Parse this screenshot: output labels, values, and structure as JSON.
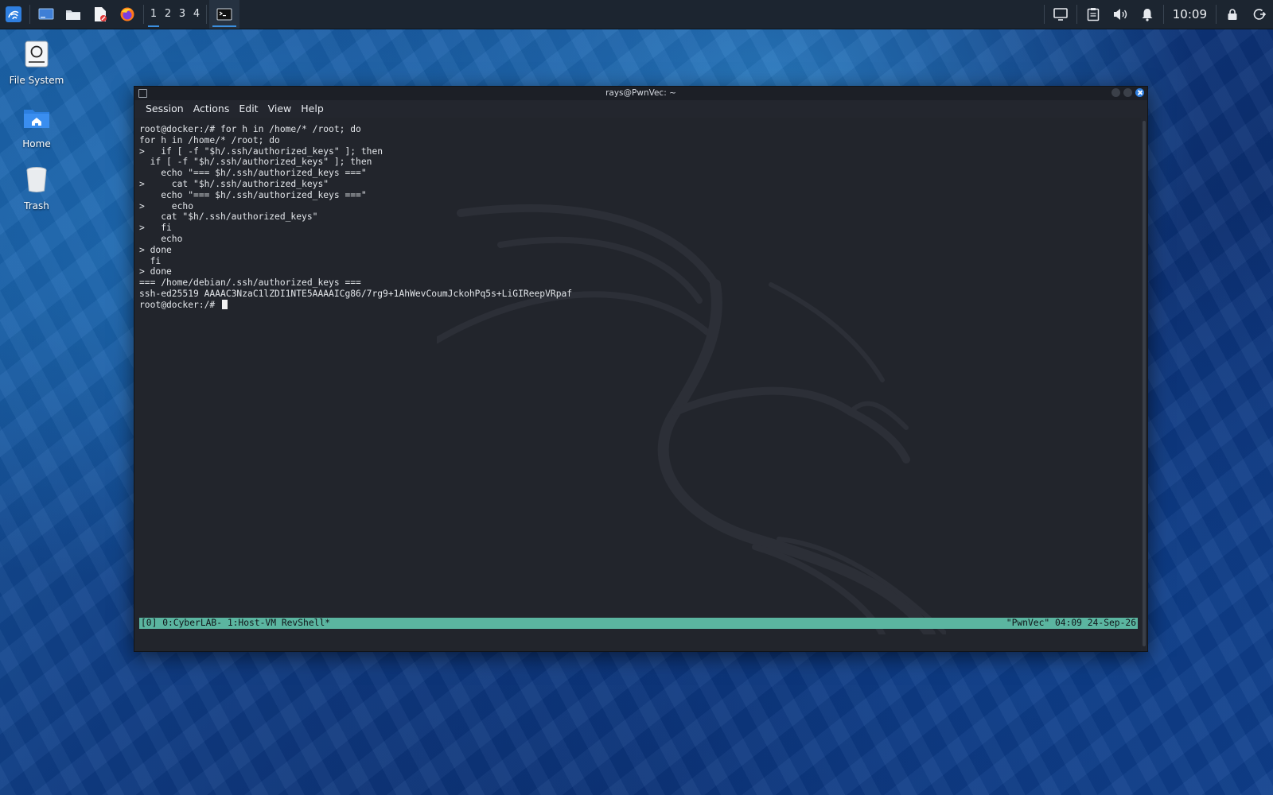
{
  "taskbar": {
    "workspaces": [
      "1",
      "2",
      "3",
      "4"
    ],
    "active_workspace": "1",
    "clock": "10:09",
    "accent": "#3b8fe0"
  },
  "desktop": {
    "icons": [
      {
        "label": "File System",
        "icon": "drive-icon"
      },
      {
        "label": "Home",
        "icon": "home-folder-icon"
      },
      {
        "label": "Trash",
        "icon": "trash-icon"
      }
    ]
  },
  "window": {
    "title": "rays@PwnVec: ~",
    "menu": [
      "Session",
      "Actions",
      "Edit",
      "View",
      "Help"
    ]
  },
  "terminal": {
    "lines": [
      "root@docker:/# for h in /home/* /root; do",
      "for h in /home/* /root; do",
      ">   if [ -f \"$h/.ssh/authorized_keys\" ]; then",
      "  if [ -f \"$h/.ssh/authorized_keys\" ]; then",
      "    echo \"=== $h/.ssh/authorized_keys ===\"",
      ">     cat \"$h/.ssh/authorized_keys\"",
      "    echo \"=== $h/.ssh/authorized_keys ===\"",
      ">     echo",
      "    cat \"$h/.ssh/authorized_keys\"",
      ">   fi",
      "    echo",
      "> done",
      "  fi",
      "> done",
      "=== /home/debian/.ssh/authorized_keys ===",
      "ssh-ed25519 AAAAC3NzaC1lZDI1NTE5AAAAICg86/7rg9+1AhWevCoumJckohPq5s+LiGIReepVRpaf"
    ],
    "prompt": "root@docker:/# ",
    "status_left": "[0] 0:CyberLAB- 1:Host-VM RevShell*",
    "status_right": "\"PwnVec\" 04:09 24-Sep-26",
    "status_color": "#5bb5a0"
  }
}
